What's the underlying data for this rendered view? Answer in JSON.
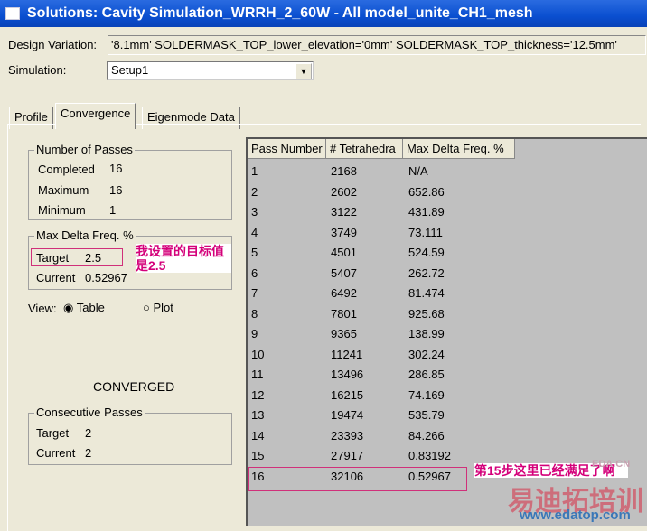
{
  "window": {
    "title": "Solutions: Cavity Simulation_WRRH_2_60W - All model_unite_CH1_mesh"
  },
  "design_variation": {
    "label": "Design Variation:",
    "value": "'8.1mm' SOLDERMASK_TOP_lower_elevation='0mm' SOLDERMASK_TOP_thickness='12.5mm'"
  },
  "simulation": {
    "label": "Simulation:",
    "value": "Setup1"
  },
  "tabs": [
    "Profile",
    "Convergence",
    "Eigenmode Data"
  ],
  "passes": {
    "title": "Number of Passes",
    "completed_label": "Completed",
    "completed": "16",
    "maximum_label": "Maximum",
    "maximum": "16",
    "minimum_label": "Minimum",
    "minimum": "1"
  },
  "delta": {
    "title": "Max Delta Freq. %",
    "target_label": "Target",
    "target": "2.5",
    "current_label": "Current",
    "current": "0.52967"
  },
  "view": {
    "label": "View:",
    "table": "Table",
    "plot": "Plot"
  },
  "status": "CONVERGED",
  "consecutive": {
    "title": "Consecutive Passes",
    "target_label": "Target",
    "target": "2",
    "current_label": "Current",
    "current": "2"
  },
  "table": {
    "headers": [
      "Pass Number",
      "# Tetrahedra",
      "Max Delta Freq. %"
    ],
    "rows": [
      [
        "1",
        "2168",
        "N/A"
      ],
      [
        "2",
        "2602",
        "652.86"
      ],
      [
        "3",
        "3122",
        "431.89"
      ],
      [
        "4",
        "3749",
        "73.111"
      ],
      [
        "5",
        "4501",
        "524.59"
      ],
      [
        "6",
        "5407",
        "262.72"
      ],
      [
        "7",
        "6492",
        "81.474"
      ],
      [
        "8",
        "7801",
        "925.68"
      ],
      [
        "9",
        "9365",
        "138.99"
      ],
      [
        "10",
        "11241",
        "302.24"
      ],
      [
        "11",
        "13496",
        "286.85"
      ],
      [
        "12",
        "16215",
        "74.169"
      ],
      [
        "13",
        "19474",
        "535.79"
      ],
      [
        "14",
        "23393",
        "84.266"
      ],
      [
        "15",
        "27917",
        "0.83192"
      ],
      [
        "16",
        "32106",
        "0.52967"
      ]
    ]
  },
  "annotations": {
    "target_note": "我设置的目标值是2.5",
    "pass15_note": "第15步这里已经满足了啊"
  },
  "watermark": {
    "brand": "易迪拓培训",
    "url": "www.edatop.com",
    "small": "EDA.CN"
  }
}
